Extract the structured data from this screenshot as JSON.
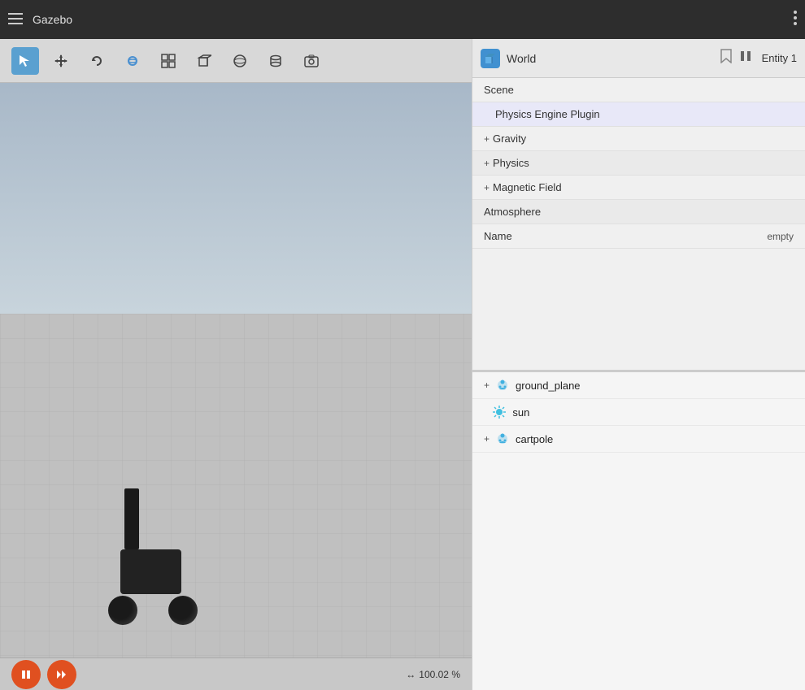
{
  "app": {
    "title": "Gazebo",
    "menu_icon": "☰",
    "dots_icon": "⋮"
  },
  "toolbar": {
    "tools": [
      {
        "name": "select",
        "icon": "↖",
        "label": "Select",
        "active": true
      },
      {
        "name": "move",
        "icon": "✥",
        "label": "Move"
      },
      {
        "name": "rotate",
        "icon": "↻",
        "label": "Rotate"
      },
      {
        "name": "orbit",
        "icon": "🌐",
        "label": "Orbit"
      },
      {
        "name": "grid",
        "icon": "⊞",
        "label": "Grid"
      },
      {
        "name": "box",
        "icon": "⬜",
        "label": "Box"
      },
      {
        "name": "sphere",
        "icon": "○",
        "label": "Sphere"
      },
      {
        "name": "cylinder",
        "icon": "▯",
        "label": "Cylinder"
      },
      {
        "name": "screenshot",
        "icon": "📷",
        "label": "Screenshot"
      }
    ]
  },
  "world_panel": {
    "icon": "▣",
    "title": "World",
    "bookmark_icon": "🔖",
    "pause_icon": "⏸",
    "entity_label": "Entity 1",
    "properties": [
      {
        "label": "Scene",
        "type": "item",
        "indent": 0
      },
      {
        "label": "Physics Engine Plugin",
        "type": "item",
        "indent": 1
      },
      {
        "label": "Gravity",
        "type": "expandable",
        "indent": 0
      },
      {
        "label": "Physics",
        "type": "expandable",
        "indent": 0
      },
      {
        "label": "Magnetic Field",
        "type": "expandable",
        "indent": 0
      },
      {
        "label": "Atmosphere",
        "type": "item",
        "indent": 0
      },
      {
        "label": "Name",
        "type": "item",
        "indent": 0,
        "value": "empty"
      }
    ]
  },
  "entities": [
    {
      "name": "ground_plane",
      "type": "model",
      "expandable": true
    },
    {
      "name": "sun",
      "type": "light",
      "expandable": false
    },
    {
      "name": "cartpole",
      "type": "model",
      "expandable": true
    }
  ],
  "statusbar": {
    "play_icon": "⏸",
    "fast_forward_icon": "⏩",
    "zoom_arrow": "↔",
    "zoom_label": "100.02 %"
  }
}
